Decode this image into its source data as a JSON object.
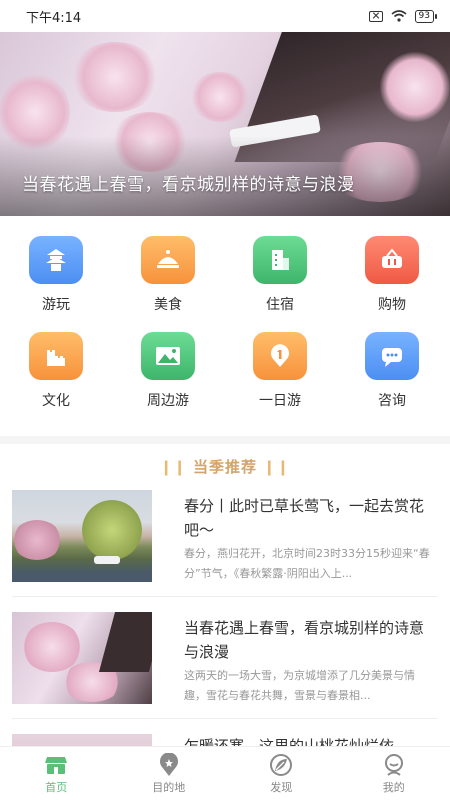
{
  "status": {
    "time": "下午4:14",
    "battery": "93"
  },
  "banner": {
    "title": "当春花遇上春雪，看京城别样的诗意与浪漫",
    "dots": 5,
    "active_dot": 1
  },
  "categories": [
    {
      "label": "游玩",
      "icon": "pagoda-icon",
      "color": "#5b9cf7"
    },
    {
      "label": "美食",
      "icon": "food-dome-icon",
      "color": "#f8a14a"
    },
    {
      "label": "住宿",
      "icon": "building-icon",
      "color": "#4fc37a"
    },
    {
      "label": "购物",
      "icon": "basket-icon",
      "color": "#f56c5a"
    },
    {
      "label": "文化",
      "icon": "great-wall-icon",
      "color": "#f8a14a"
    },
    {
      "label": "周边游",
      "icon": "mountain-icon",
      "color": "#4fc37a"
    },
    {
      "label": "一日游",
      "icon": "one-day-icon",
      "color": "#f8a14a"
    },
    {
      "label": "咨询",
      "icon": "chat-icon",
      "color": "#5b9cf7"
    }
  ],
  "section_title": "当季推荐",
  "news": [
    {
      "title": "春分丨此时已草长莺飞，一起去赏花吧～",
      "desc": "春分，燕归花开，北京时间23时33分15秒迎来“春分”节气，《春秋繁露·阴阳出入上..."
    },
    {
      "title": "当春花遇上春雪，看京城别样的诗意与浪漫",
      "desc": "这两天的一场大雪，为京城增添了几分美景与情趣，雪花与春花共舞，雪景与春景相..."
    },
    {
      "title": "乍暖还寒，这里的山桃花灿烂依",
      "desc": ""
    }
  ],
  "tabs": [
    {
      "label": "首页",
      "icon": "home-shop-icon"
    },
    {
      "label": "目的地",
      "icon": "location-pin-icon"
    },
    {
      "label": "发现",
      "icon": "discover-leaf-icon"
    },
    {
      "label": "我的",
      "icon": "user-icon"
    }
  ],
  "colors": {
    "accent": "#5bbf7a",
    "section": "#d5a46a"
  }
}
